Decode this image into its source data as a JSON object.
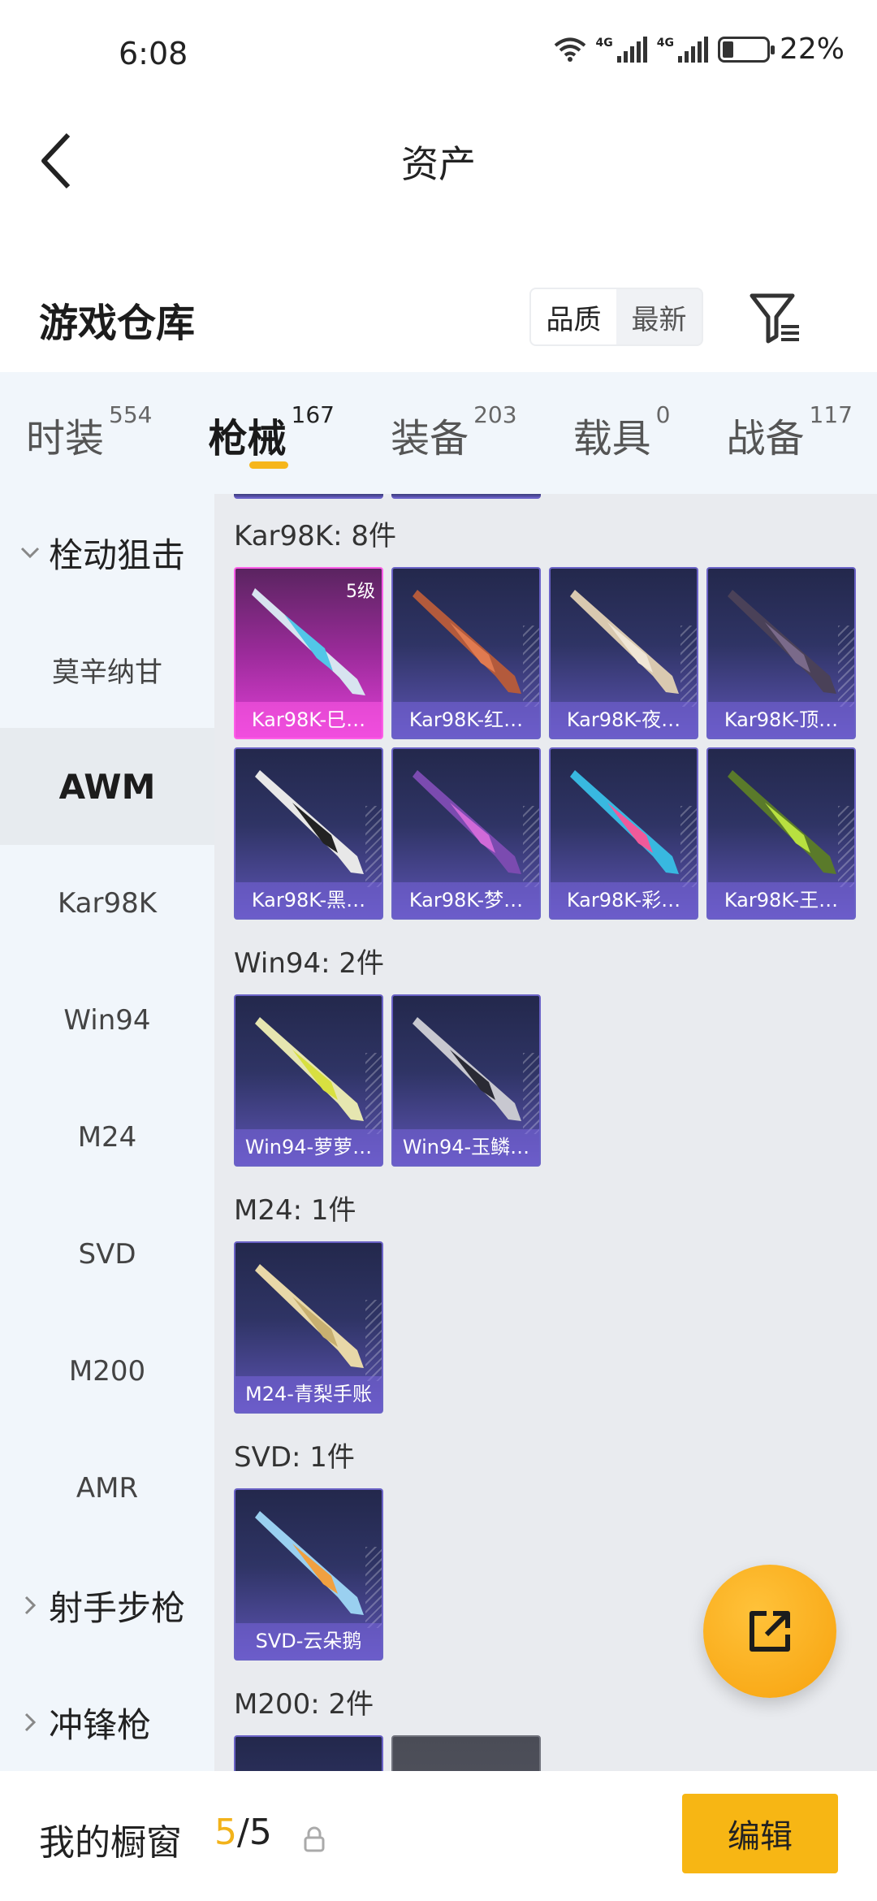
{
  "status": {
    "time": "6:08",
    "net1": "4G",
    "net2": "4G",
    "battery": "22%"
  },
  "header": {
    "title": "资产"
  },
  "warehouse": {
    "title": "游戏仓库",
    "sort_quality": "品质",
    "sort_newest": "最新"
  },
  "tabs": [
    {
      "label": "时装",
      "count": "554"
    },
    {
      "label": "枪械",
      "count": "167"
    },
    {
      "label": "装备",
      "count": "203"
    },
    {
      "label": "载具",
      "count": "0"
    },
    {
      "label": "战备",
      "count": "117"
    }
  ],
  "sidebar": {
    "group1": "栓动狙击",
    "items": [
      "莫辛纳甘",
      "AWM",
      "Kar98K",
      "Win94",
      "M24",
      "SVD",
      "M200",
      "AMR"
    ],
    "group2": "射手步枪",
    "group3": "冲锋枪"
  },
  "sections": {
    "kar98k": {
      "title": "Kar98K: 8件",
      "tier": "5级",
      "items": [
        "Kar98K-巳…",
        "Kar98K-红…",
        "Kar98K-夜…",
        "Kar98K-顶…",
        "Kar98K-黑…",
        "Kar98K-梦…",
        "Kar98K-彩…",
        "Kar98K-王…"
      ]
    },
    "win94": {
      "title": "Win94: 2件",
      "items": [
        "Win94-萝萝…",
        "Win94-玉鳞…"
      ]
    },
    "m24": {
      "title": "M24: 1件",
      "items": [
        "M24-青梨手账"
      ]
    },
    "svd": {
      "title": "SVD: 1件",
      "items": [
        "SVD-云朵鹅"
      ]
    },
    "m200": {
      "title": "M200: 2件"
    }
  },
  "bottom": {
    "label": "我的橱窗",
    "current": "5",
    "separator": "/",
    "max": "5",
    "edit": "编辑"
  },
  "colors": {
    "accent": "#f7b614",
    "card_top": "#23284c",
    "card_bottom": "#5d54b4",
    "legend_card": "#e03fd6"
  }
}
